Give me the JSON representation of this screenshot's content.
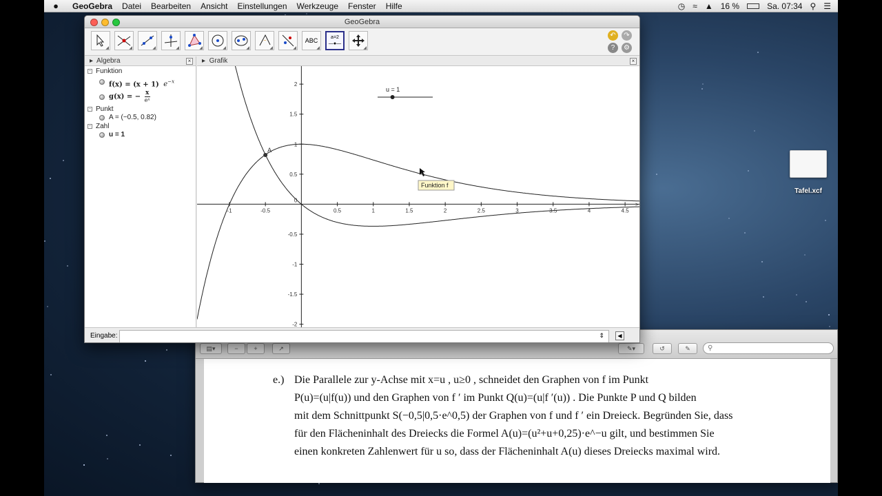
{
  "menubar": {
    "apple": "",
    "app_name": "GeoGebra",
    "items": [
      "Datei",
      "Bearbeiten",
      "Ansicht",
      "Einstellungen",
      "Werkzeuge",
      "Fenster",
      "Hilfe"
    ],
    "battery": "16 %",
    "clock": "Sa. 07:34"
  },
  "window": {
    "title": "GeoGebra",
    "toolbar": {
      "text_tool_label": "ABC",
      "slider_tool_label": "a=2",
      "selected_tool": "slider"
    },
    "algebra": {
      "header": "Algebra",
      "groups": [
        {
          "label": "Funktion",
          "items": [
            {
              "name": "f(x) = (x + 1)",
              "rest": "e^{-x}"
            },
            {
              "name": "g(x) = −",
              "frac_num": "x",
              "frac_den": "eˣ"
            }
          ]
        },
        {
          "label": "Punkt",
          "items": [
            {
              "text": "A = (−0.5, 0.82)"
            }
          ]
        },
        {
          "label": "Zahl",
          "items": [
            {
              "text": "u = 1"
            }
          ]
        }
      ]
    },
    "graphics": {
      "header": "Grafik",
      "slider_label": "u = 1",
      "point_label": "A",
      "tooltip": "Funktion f",
      "x_ticks": [
        "-1",
        "-0.5",
        "0",
        "0.5",
        "1",
        "1.5",
        "2",
        "2.5",
        "3",
        "3.5",
        "4",
        "4.5"
      ],
      "y_ticks": [
        "2",
        "1.5",
        "1",
        "0.5",
        "-0.5",
        "-1",
        "-1.5",
        "-2"
      ],
      "origin_label": "0"
    },
    "input": {
      "label": "Eingabe:",
      "value": ""
    }
  },
  "chart_data": {
    "type": "line",
    "xlim": [
      -1.45,
      4.7
    ],
    "ylim": [
      -2.05,
      2.3
    ],
    "series": [
      {
        "name": "f",
        "expression": "(x+1)*exp(-x)"
      },
      {
        "name": "g",
        "expression": "-x/exp(x)"
      }
    ],
    "points": [
      {
        "label": "A",
        "x": -0.5,
        "y": 0.82
      }
    ],
    "slider": {
      "name": "u",
      "value": 1
    }
  },
  "pdf": {
    "search_placeholder": "",
    "task": {
      "number": "e.)",
      "lines": [
        "Die Parallele zur y-Achse mit x=u , u≥0 , schneidet den Graphen von f im Punkt",
        "P(u)=(u|f(u)) und den Graphen von f ′ im Punkt Q(u)=(u|f ′(u)) . Die Punkte P und Q bilden",
        "mit dem Schnittpunkt S(−0,5|0,5·e^0,5) der Graphen von f und f ′ ein Dreieck. Begründen Sie, dass",
        "für den Flächeninhalt des Dreiecks die Formel A(u)=(u²+u+0,25)·e^−u gilt, und bestimmen Sie",
        "einen konkreten Zahlenwert für u so, dass der Flächeninhalt A(u) dieses Dreiecks maximal wird."
      ]
    }
  },
  "desktop": {
    "file_name": "Tafel.xcf"
  }
}
